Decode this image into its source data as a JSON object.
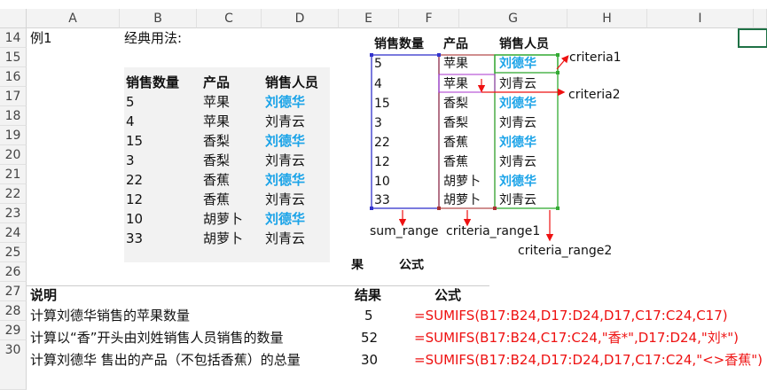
{
  "columns": [
    "A",
    "B",
    "C",
    "D",
    "E",
    "F",
    "G",
    "H",
    "I"
  ],
  "rows": [
    "14",
    "15",
    "16",
    "17",
    "18",
    "19",
    "20",
    "21",
    "22",
    "23",
    "24",
    "25",
    "26",
    "27",
    "28",
    "29",
    "30"
  ],
  "cells": {
    "a14": "例1",
    "b14": "经典用法:"
  },
  "table1": {
    "headers": [
      "销售数量",
      "产品",
      "销售人员"
    ],
    "rows": [
      [
        "5",
        "苹果",
        "刘德华"
      ],
      [
        "4",
        "苹果",
        "刘青云"
      ],
      [
        "15",
        "香梨",
        "刘德华"
      ],
      [
        "3",
        "香梨",
        "刘青云"
      ],
      [
        "22",
        "香蕉",
        "刘德华"
      ],
      [
        "12",
        "香蕉",
        "刘青云"
      ],
      [
        "10",
        "胡萝卜",
        "刘德华"
      ],
      [
        "33",
        "胡萝卜",
        "刘青云"
      ]
    ]
  },
  "table2": {
    "headers": [
      "销售数量",
      "产品",
      "销售人员"
    ],
    "rows": [
      [
        "5",
        "苹果",
        "刘德华"
      ],
      [
        "4",
        "苹果",
        "刘青云"
      ],
      [
        "15",
        "香梨",
        "刘德华"
      ],
      [
        "3",
        "香梨",
        "刘青云"
      ],
      [
        "22",
        "香蕉",
        "刘德华"
      ],
      [
        "12",
        "香蕉",
        "刘青云"
      ],
      [
        "10",
        "胡萝卜",
        "刘德华"
      ],
      [
        "33",
        "胡萝卜",
        "刘青云"
      ]
    ]
  },
  "annotations": {
    "criteria1": "criteria1",
    "criteria2": "criteria2",
    "sum_range": "sum_range",
    "criteria_range1": "criteria_range1",
    "criteria_range2": "criteria_range2",
    "partial_left": "果",
    "partial_right": "公式"
  },
  "explain": {
    "header_desc": "说明",
    "header_result": "结果",
    "header_formula": "公式",
    "rows": [
      {
        "desc": "计算刘德华销售的苹果数量",
        "result": "5",
        "formula": "=SUMIFS(B17:B24,D17:D24,D17,C17:C24,C17)"
      },
      {
        "desc": "计算以“香”开头由刘姓销售人员销售的数量",
        "result": "52",
        "formula": "=SUMIFS(B17:B24,C17:C24,\"香*\",D17:D24,\"刘*\")"
      },
      {
        "desc": "计算刘德华 售出的产品（不包括香蕉）的总量",
        "result": "30",
        "formula": "=SUMIFS(B17:B24,D17:D24,D17,C17:C24,\"<>香蕉\")"
      }
    ]
  },
  "colors": {
    "highlight_name": "#1aa3e8",
    "formula": "#ee1111",
    "sum_range_box": "#3333cc",
    "criteria_range1_box": "#aa3333",
    "criteria_range2_box": "#33aa33",
    "arrow": "#ee1111"
  }
}
